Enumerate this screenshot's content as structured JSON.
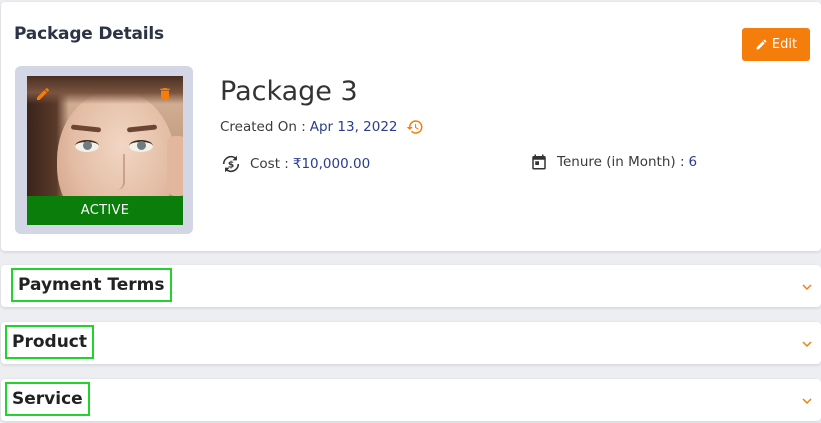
{
  "card": {
    "title": "Package Details",
    "edit_label": "Edit",
    "status": "ACTIVE",
    "package_name": "Package 3",
    "created_label": "Created On :",
    "created_value": "Apr 13, 2022",
    "cost_label": "Cost :",
    "cost_value": "₹10,000.00",
    "tenure_label": "Tenure (in Month) :",
    "tenure_value": "6"
  },
  "sections": [
    {
      "label": "Payment Terms"
    },
    {
      "label": "Product"
    },
    {
      "label": "Service"
    }
  ],
  "colors": {
    "accent": "#f47d0c",
    "status_active": "#0a7d0a",
    "value_text": "#2b3c8e",
    "highlight_box": "#21d32c"
  },
  "icons": {
    "edit_button": "pencil-icon",
    "photo_edit": "pencil-icon",
    "photo_delete": "trash-icon",
    "history": "history-icon",
    "cost": "currency-sync-icon",
    "tenure": "calendar-icon",
    "section_toggle": "chevron-down-icon"
  }
}
